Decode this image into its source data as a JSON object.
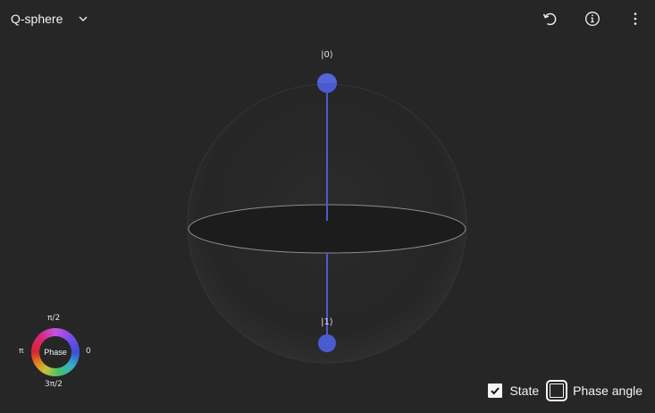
{
  "header": {
    "view_select": {
      "label": "Q-sphere",
      "icon": "chevron-down-icon"
    },
    "actions": [
      {
        "name": "reset-view-button",
        "icon": "reset-icon"
      },
      {
        "name": "info-button",
        "icon": "info-icon"
      },
      {
        "name": "overflow-menu-button",
        "icon": "overflow-menu-vertical-icon"
      }
    ]
  },
  "qsphere": {
    "states": [
      {
        "label": "|0⟩",
        "color": "#4a5bd0"
      },
      {
        "label": "|1⟩",
        "color": "#4a5bd0"
      }
    ],
    "vector_color": "#4a5bd0",
    "sphere_edge_color": "#3a3a3a"
  },
  "phase_legend": {
    "title": "Phase",
    "top": "π/2",
    "right": "0",
    "left": "π",
    "bottom": "3π/2"
  },
  "toggles": {
    "state": {
      "label": "State",
      "checked": true
    },
    "phase_angle": {
      "label": "Phase angle",
      "checked": false
    }
  }
}
